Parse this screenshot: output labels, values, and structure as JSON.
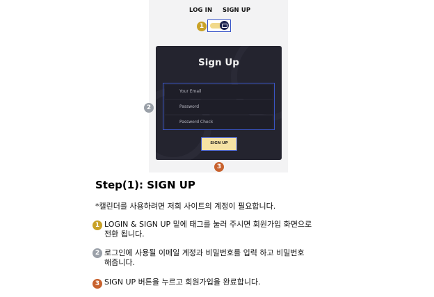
{
  "screenshot": {
    "tabs": {
      "login": "LOG IN",
      "signup": "SIGN UP"
    },
    "panel": {
      "title": "Sign Up",
      "email_placeholder": "Your Email",
      "password_placeholder": "Password",
      "password_check_placeholder": "Password Check",
      "submit_label": "SIGN UP"
    },
    "badges": {
      "one": "1",
      "two": "2",
      "three": "3"
    }
  },
  "instructions": {
    "title": "Step(1): SIGN UP",
    "note": "*캘린더를 사용하려면 저희 사이트의 계정이 필요합니다.",
    "items": [
      {
        "badge": "1",
        "lines": [
          "LOGIN & SIGN UP 밑에 태그를 눌러 주시면 회원가입 화면으로",
          "전환 됩니다."
        ]
      },
      {
        "badge": "2",
        "lines": [
          "로그인에 사용될 이메일 계정과 비밀번호를 입력 하고 비밀번호",
          "해줍니다."
        ]
      },
      {
        "badge": "3",
        "lines": [
          "SIGN UP 버튼을 누르고 회원가입을 완료합니다."
        ]
      }
    ]
  },
  "colors": {
    "highlight_border": "#3a56c9",
    "badge_1": "#c9a227",
    "badge_2": "#9aa0a8",
    "badge_3": "#c8622e",
    "panel_bg": "#24242f",
    "button_bg": "#f5e2a4"
  }
}
